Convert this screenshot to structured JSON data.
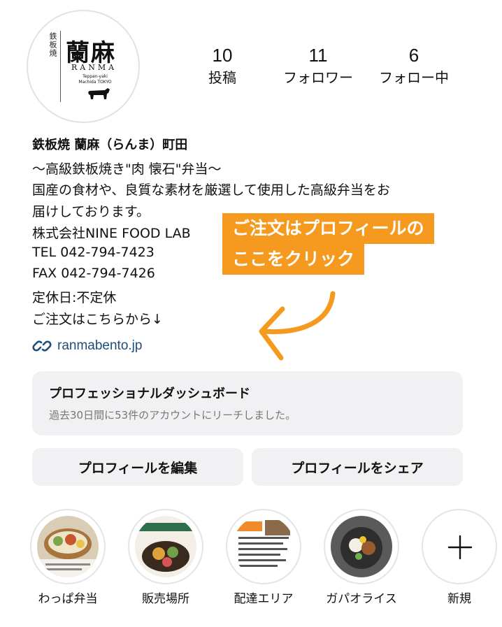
{
  "profile": {
    "logo": {
      "kanji_small": "鉄板焼",
      "kanji_main": "蘭麻",
      "romaji": "RANMA",
      "subtitle_line1": "Teppan-yaki",
      "subtitle_line2": "Machida TOKYO"
    },
    "stats": [
      {
        "value": "10",
        "label": "投稿"
      },
      {
        "value": "11",
        "label": "フォロワー"
      },
      {
        "value": "6",
        "label": "フォロー中"
      }
    ],
    "name": "鉄板焼 蘭麻（らんま）町田",
    "bio": [
      "〜高級鉄板焼き\"肉 懐石\"弁当〜",
      "国産の食材や、良質な素材を厳選して使用した高級弁当をお",
      "届けしております。",
      "株式会社NINE FOOD LAB",
      "TEL 042-794-7423",
      "FAX 042-794-7426",
      "定休日:不定休",
      "ご注文はこちらから↓"
    ],
    "link": "ranmabento.jp"
  },
  "callout": {
    "line1": "ご注文はプロフィールの",
    "line2": "ここをクリック",
    "color": "#f59a1e"
  },
  "dashboard": {
    "title": "プロフェッショナルダッシュボード",
    "subtitle": "過去30日間に53件のアカウントにリーチしました。"
  },
  "buttons": {
    "edit": "プロフィールを編集",
    "share": "プロフィールをシェア"
  },
  "highlights": [
    {
      "label": "わっぱ弁当",
      "icon": "bento-photo"
    },
    {
      "label": "販売場所",
      "icon": "sales-flyer"
    },
    {
      "label": "配達エリア",
      "icon": "delivery-flyer"
    },
    {
      "label": "ガパオライス",
      "icon": "gapao-photo"
    },
    {
      "label": "新規",
      "icon": "plus-icon"
    }
  ]
}
